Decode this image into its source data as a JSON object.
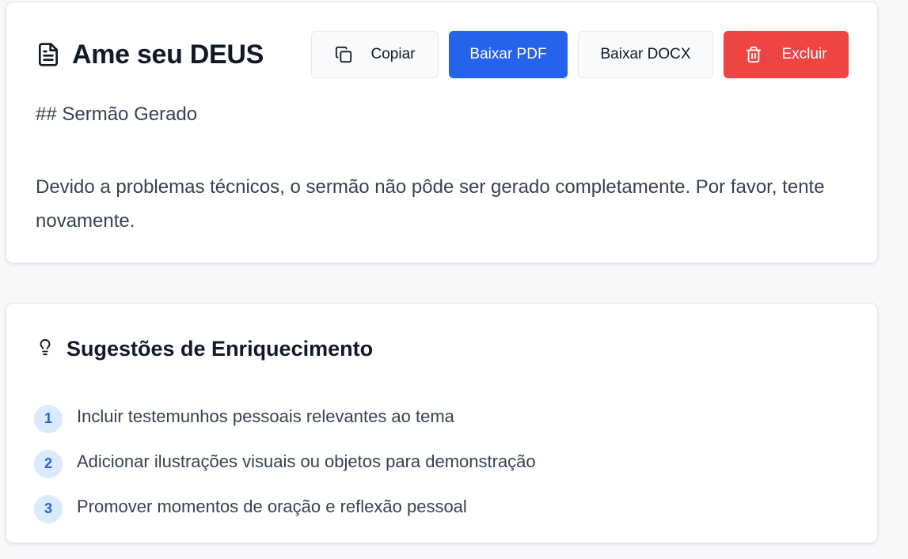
{
  "sermon": {
    "title": "Ame seu DEUS",
    "heading": "## Sermão Gerado",
    "body": "Devido a problemas técnicos, o sermão não pôde ser gerado completamente. Por favor, tente novamente.",
    "actions": {
      "copy_label": "Copiar",
      "pdf_label": "Baixar PDF",
      "docx_label": "Baixar DOCX",
      "delete_label": "Excluir"
    },
    "icons": {
      "title": "document-icon",
      "copy": "copy-icon",
      "delete": "trash-icon"
    }
  },
  "suggestions": {
    "title": "Sugestões de Enriquecimento",
    "icon": "lightbulb-icon",
    "items": [
      {
        "number": "1",
        "text": "Incluir testemunhos pessoais relevantes ao tema"
      },
      {
        "number": "2",
        "text": "Adicionar ilustrações visuais ou objetos para demonstração"
      },
      {
        "number": "3",
        "text": "Promover momentos de oração e reflexão pessoal"
      }
    ]
  },
  "colors": {
    "primary": "#2563eb",
    "danger": "#ef4444",
    "badge_bg": "#dbeafe",
    "text_dark": "#111827",
    "text_body": "#374151",
    "page_bg": "#f7f8fa"
  }
}
